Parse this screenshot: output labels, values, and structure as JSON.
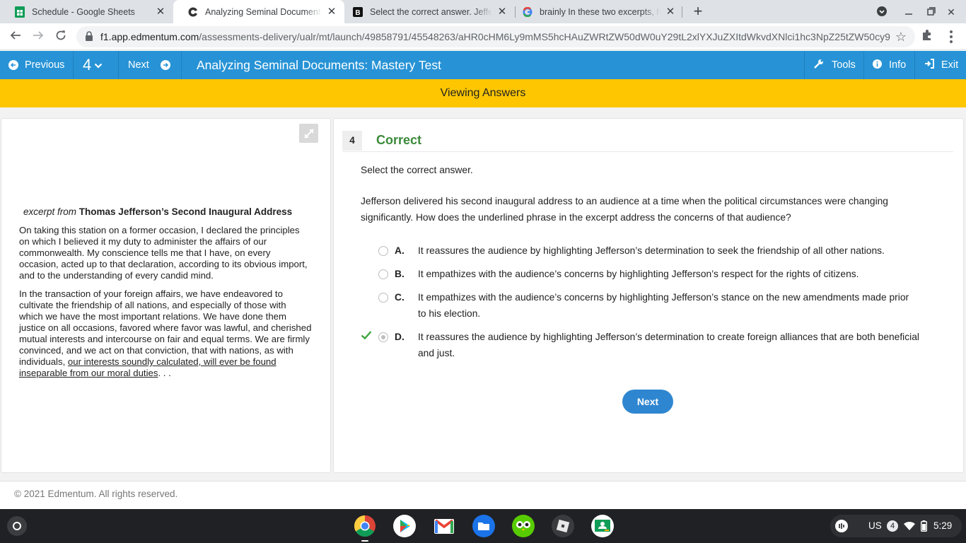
{
  "browser": {
    "tabs": [
      {
        "title": "Schedule - Google Sheets",
        "icon": "sheets-icon"
      },
      {
        "title": "Analyzing Seminal Documents: Mastery Test",
        "icon": "edmentum-icon"
      },
      {
        "title": "Select the correct answer. Jefferson delivered",
        "icon": "brainly-icon"
      },
      {
        "title": "brainly In these two excerpts, how",
        "icon": "google-icon"
      }
    ],
    "url_host": "f1.app.edmentum.com",
    "url_path": "/assessments-delivery/ualr/mt/launch/49858791/45548263/aHR0cHM6Ly9mMS5hcHAuZWRtZW50dW0uY29tL2xlYXJuZXItdWkvdXNlci1hc3NpZ25tZW50cy9"
  },
  "appbar": {
    "previous_label": "Previous",
    "question_number": "4",
    "next_label": "Next",
    "title": "Analyzing Seminal Documents: Mastery Test",
    "tools_label": "Tools",
    "info_label": "Info",
    "exit_label": "Exit",
    "color": "#2793d6"
  },
  "banner": {
    "text": "Viewing Answers",
    "color": "#fec600"
  },
  "passage": {
    "source_prefix": "excerpt from",
    "source_title": "Thomas Jefferson’s Second Inaugural Address",
    "paragraph1": "On taking this station on a former occasion, I declared the principles on which I believed it my duty to administer the affairs of our commonwealth. My conscience tells me that I have, on every occasion, acted up to that declaration, according to its obvious import, and to the understanding of every candid mind.",
    "paragraph2_before": "In the transaction of your foreign affairs, we have endeavored to cultivate the friendship of all nations, and especially of those with which we have the most important relations. We have done them justice on all occasions, favored where favor was lawful, and cherished mutual interests and intercourse on fair and equal terms. We are firmly convinced, and we act on that conviction, that with nations, as with individuals, ",
    "paragraph2_underlined": "our interests soundly calculated, will ever be found inseparable from our moral duties",
    "paragraph2_after": ". . ."
  },
  "question": {
    "number": "4",
    "status": "Correct",
    "instruction": "Select the correct answer.",
    "text": "Jefferson delivered his second inaugural address to an audience at a time when the political circumstances were changing significantly. How does the underlined phrase in the excerpt address the concerns of that audience?",
    "options": [
      {
        "letter": "A.",
        "text": "It reassures the audience by highlighting Jefferson’s determination to seek the friendship of all other nations.",
        "selected": false
      },
      {
        "letter": "B.",
        "text": "It empathizes with the audience’s concerns by highlighting Jefferson’s respect for the rights of citizens.",
        "selected": false
      },
      {
        "letter": "C.",
        "text": "It empathizes with the audience’s concerns by highlighting Jefferson’s stance on the new amendments made prior to his election.",
        "selected": false
      },
      {
        "letter": "D.",
        "text": "It reassures the audience by highlighting Jefferson’s determination to create foreign alliances that are both beneficial and just.",
        "selected": true
      }
    ],
    "next_label": "Next",
    "correct_color": "#3b8a3a"
  },
  "footer": {
    "copyright": "© 2021 Edmentum. All rights reserved."
  },
  "shelf": {
    "apps": [
      "chrome-icon",
      "play-store-icon",
      "gmail-icon",
      "files-icon",
      "duolingo-icon",
      "roblox-icon",
      "classroom-icon"
    ],
    "locale": "US",
    "notification_count": "4",
    "time": "5:29"
  }
}
